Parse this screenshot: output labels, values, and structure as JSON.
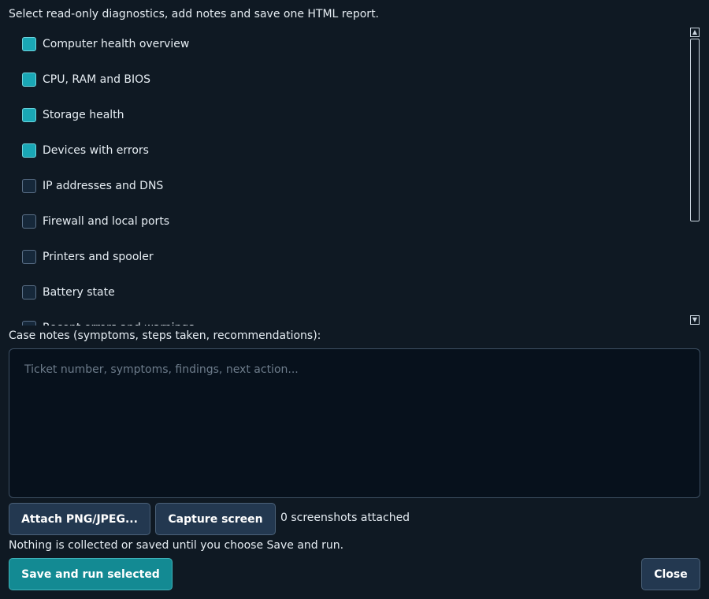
{
  "intro": "Select read-only diagnostics, add notes and save one HTML report.",
  "diagnostics": [
    {
      "label": "Computer health overview",
      "checked": true
    },
    {
      "label": "CPU, RAM and BIOS",
      "checked": true
    },
    {
      "label": "Storage health",
      "checked": true
    },
    {
      "label": "Devices with errors",
      "checked": true
    },
    {
      "label": "IP addresses and DNS",
      "checked": false
    },
    {
      "label": "Firewall and local ports",
      "checked": false
    },
    {
      "label": "Printers and spooler",
      "checked": false
    },
    {
      "label": "Battery state",
      "checked": false
    },
    {
      "label": "Recent errors and warnings",
      "checked": false
    }
  ],
  "notes": {
    "label": "Case notes (symptoms, steps taken, recommendations):",
    "placeholder": "Ticket number, symptoms, findings, next action...",
    "value": ""
  },
  "attachments": {
    "attach_label": "Attach PNG/JPEG...",
    "capture_label": "Capture screen",
    "status": "0 screenshots attached"
  },
  "info": "Nothing is collected or saved until you choose Save and run.",
  "actions": {
    "primary_label": "Save and run selected",
    "close_label": "Close"
  },
  "icons": {
    "scroll_up": "scroll-up-arrow-icon",
    "scroll_down": "scroll-down-arrow-icon"
  },
  "colors": {
    "background": "#0f1923",
    "checked": "#1aa7b5",
    "primary_button": "#138a93",
    "button": "#233850"
  }
}
